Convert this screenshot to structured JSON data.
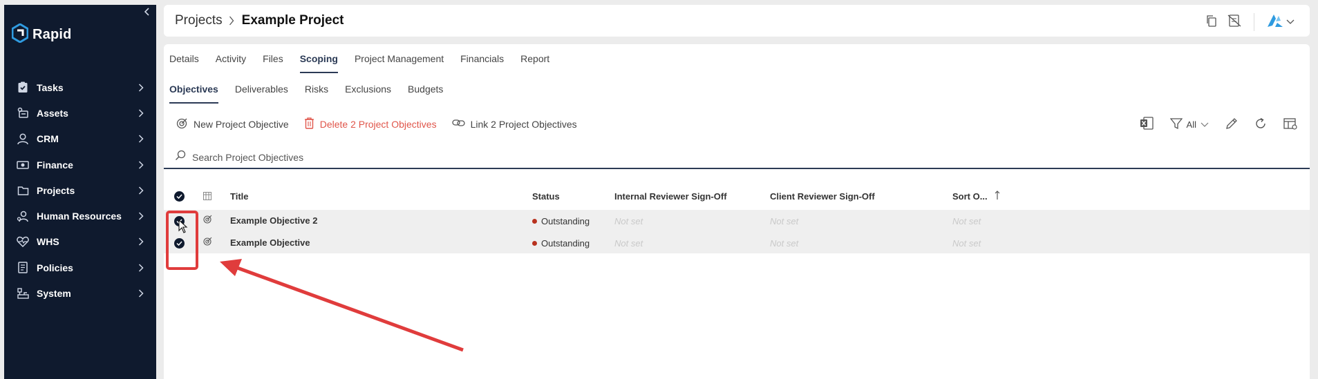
{
  "sidebar": {
    "logo_text": "Rapid",
    "items": [
      {
        "label": "Tasks",
        "icon": "clipboard-check-icon"
      },
      {
        "label": "Assets",
        "icon": "assets-icon"
      },
      {
        "label": "CRM",
        "icon": "user-icon"
      },
      {
        "label": "Finance",
        "icon": "money-icon"
      },
      {
        "label": "Projects",
        "icon": "folder-icon"
      },
      {
        "label": "Human Resources",
        "icon": "people-icon"
      },
      {
        "label": "WHS",
        "icon": "heart-pulse-icon"
      },
      {
        "label": "Policies",
        "icon": "document-icon"
      },
      {
        "label": "System",
        "icon": "hierarchy-icon"
      }
    ]
  },
  "header": {
    "crumb_parent": "Projects",
    "crumb_current": "Example Project"
  },
  "tabs": [
    "Details",
    "Activity",
    "Files",
    "Scoping",
    "Project Management",
    "Financials",
    "Report"
  ],
  "active_tab": "Scoping",
  "subtabs": [
    "Objectives",
    "Deliverables",
    "Risks",
    "Exclusions",
    "Budgets"
  ],
  "active_subtab": "Objectives",
  "toolbar": {
    "new_label": "New Project Objective",
    "delete_label": "Delete 2 Project Objectives",
    "link_label": "Link 2 Project Objectives",
    "filter_label": "All"
  },
  "search": {
    "placeholder": "Search Project Objectives"
  },
  "table": {
    "columns": [
      "Title",
      "Status",
      "Internal Reviewer Sign-Off",
      "Client Reviewer Sign-Off",
      "Sort O..."
    ],
    "rows": [
      {
        "title": "Example Objective 2",
        "status": "Outstanding",
        "internal": "Not set",
        "client": "Not set",
        "sort": "Not set",
        "selected": true
      },
      {
        "title": "Example Objective",
        "status": "Outstanding",
        "internal": "Not set",
        "client": "Not set",
        "sort": "Not set",
        "selected": true
      }
    ]
  },
  "colors": {
    "sidebar_bg": "#0f1a2e",
    "accent": "#2b3a55",
    "danger": "#e0554a",
    "status_outstanding": "#b8321f",
    "annotation": "#e03c3c",
    "logo_blue": "#2f9be0"
  }
}
